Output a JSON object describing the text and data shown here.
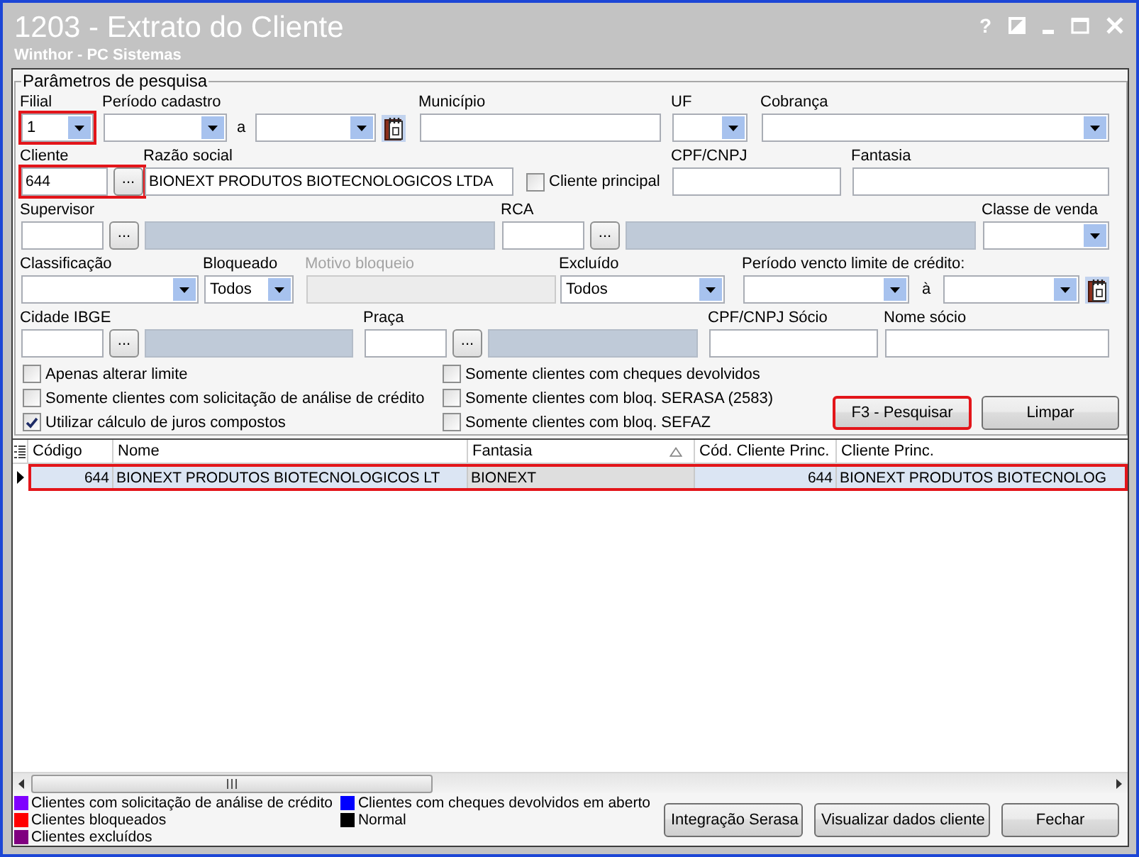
{
  "window": {
    "title": "1203 - Extrato do Cliente",
    "subtitle": "Winthor - PC Sistemas",
    "buttons": [
      {
        "kind": "help",
        "label": "?"
      },
      {
        "kind": "restore"
      },
      {
        "kind": "minimize"
      },
      {
        "kind": "maximize"
      },
      {
        "kind": "close"
      }
    ]
  },
  "search_panel": {
    "legend": "Parâmetros de pesquisa",
    "rows": [
      {
        "fields": [
          {
            "label": "Filial",
            "disabled": false,
            "highlighted": true,
            "controls": [
              {
                "kind": "select",
                "value": "1"
              }
            ]
          },
          {
            "label": "Período cadastro",
            "disabled": false,
            "highlighted": false,
            "controls": [
              {
                "kind": "select"
              },
              {
                "kind": "separator",
                "text": "a"
              },
              {
                "kind": "select"
              },
              {
                "kind": "calendar"
              }
            ]
          },
          {
            "label": "Município",
            "disabled": false,
            "highlighted": false,
            "controls": [
              {
                "kind": "input"
              }
            ]
          },
          {
            "label": "UF",
            "disabled": false,
            "highlighted": false,
            "controls": [
              {
                "kind": "select"
              }
            ]
          },
          {
            "label": "Cobrança",
            "disabled": false,
            "highlighted": false,
            "controls": [
              {
                "kind": "select"
              }
            ]
          }
        ]
      },
      {
        "fields": [
          {
            "label": "Cliente",
            "disabled": false,
            "highlighted": true,
            "controls": [
              {
                "kind": "input",
                "value": "644"
              },
              {
                "kind": "lookup",
                "label": "..."
              }
            ]
          },
          {
            "label": "Razão social",
            "disabled": false,
            "highlighted": false,
            "controls": [
              {
                "kind": "input",
                "value": "BIONEXT PRODUTOS BIOTECNOLOGICOS LTDA"
              }
            ]
          },
          {
            "disabled": false,
            "highlighted": false,
            "controls": [
              {
                "kind": "checkbox",
                "label": "Cliente principal",
                "checked": false
              }
            ]
          },
          {
            "label": "CPF/CNPJ",
            "disabled": false,
            "highlighted": false,
            "controls": [
              {
                "kind": "input"
              }
            ]
          },
          {
            "label": "Fantasia",
            "disabled": false,
            "highlighted": false,
            "controls": [
              {
                "kind": "input"
              }
            ]
          }
        ]
      },
      {
        "fields": [
          {
            "label": "Supervisor",
            "disabled": false,
            "highlighted": false,
            "controls": [
              {
                "kind": "input"
              },
              {
                "kind": "lookup",
                "label": "..."
              },
              {
                "kind": "readonly"
              }
            ]
          },
          {
            "label": "RCA",
            "disabled": false,
            "highlighted": false,
            "controls": [
              {
                "kind": "input"
              },
              {
                "kind": "lookup",
                "label": "..."
              },
              {
                "kind": "readonly"
              }
            ]
          },
          {
            "label": "Classe de venda",
            "disabled": false,
            "highlighted": false,
            "controls": [
              {
                "kind": "select"
              }
            ]
          }
        ]
      },
      {
        "fields": [
          {
            "label": "Classificação",
            "disabled": false,
            "highlighted": false,
            "controls": [
              {
                "kind": "select"
              }
            ]
          },
          {
            "label": "Bloqueado",
            "disabled": false,
            "highlighted": false,
            "controls": [
              {
                "kind": "select",
                "value": "Todos"
              }
            ]
          },
          {
            "label": "Motivo bloqueio",
            "disabled": true,
            "highlighted": false,
            "controls": [
              {
                "kind": "input"
              }
            ]
          },
          {
            "label": "Excluído",
            "disabled": false,
            "highlighted": false,
            "controls": [
              {
                "kind": "select",
                "value": "Todos"
              }
            ]
          },
          {
            "label": "Período vencto limite de crédito:",
            "disabled": false,
            "highlighted": false,
            "controls": [
              {
                "kind": "select"
              },
              {
                "kind": "separator",
                "text": "à"
              },
              {
                "kind": "select"
              },
              {
                "kind": "calendar"
              }
            ]
          }
        ]
      },
      {
        "fields": [
          {
            "label": "Cidade IBGE",
            "disabled": false,
            "highlighted": false,
            "controls": [
              {
                "kind": "input"
              },
              {
                "kind": "lookup",
                "label": "..."
              },
              {
                "kind": "readonly"
              }
            ]
          },
          {
            "label": "Praça",
            "disabled": false,
            "highlighted": false,
            "controls": [
              {
                "kind": "input"
              },
              {
                "kind": "lookup",
                "label": "..."
              },
              {
                "kind": "readonly"
              }
            ]
          },
          {
            "label": "CPF/CNPJ Sócio",
            "disabled": false,
            "highlighted": false,
            "controls": [
              {
                "kind": "input"
              }
            ]
          },
          {
            "label": "Nome sócio",
            "disabled": false,
            "highlighted": false,
            "controls": [
              {
                "kind": "input"
              }
            ]
          }
        ]
      }
    ],
    "option_columns": [
      {
        "options": [
          {
            "label": "Apenas alterar limite",
            "checked": false
          },
          {
            "label": "Somente clientes com solicitação de análise de crédito",
            "checked": false
          },
          {
            "label": "Utilizar cálculo de juros compostos",
            "checked": true
          }
        ]
      },
      {
        "options": [
          {
            "label": "Somente clientes com cheques devolvidos",
            "checked": false
          },
          {
            "label": "Somente clientes com bloq. SERASA (2583)",
            "checked": false
          },
          {
            "label": "Somente clientes com bloq. SEFAZ",
            "checked": false
          }
        ]
      }
    ],
    "buttons": [
      {
        "label": "F3 - Pesquisar",
        "highlighted": true
      },
      {
        "label": "Limpar",
        "highlighted": false
      }
    ]
  },
  "results": {
    "columns": [
      {
        "label": "Código",
        "kind": "number",
        "sorted": false
      },
      {
        "label": "Nome",
        "kind": "text",
        "sorted": false
      },
      {
        "label": "Fantasia",
        "kind": "text",
        "sorted": true
      },
      {
        "label": "Cód. Cliente Princ.",
        "kind": "number",
        "sorted": false
      },
      {
        "label": "Cliente Princ.",
        "kind": "text",
        "sorted": false
      }
    ],
    "rows": [
      {
        "current": true,
        "selected": true,
        "highlighted": true,
        "cells": [
          "644",
          "BIONEXT PRODUTOS BIOTECNOLOGICOS LT",
          "BIONEXT",
          "644",
          "BIONEXT PRODUTOS BIOTECNOLOG"
        ]
      }
    ]
  },
  "legend_columns": [
    {
      "items": [
        {
          "label": "Clientes com solicitação de análise de crédito",
          "color": "#8000ff"
        },
        {
          "label": "Clientes bloqueados",
          "color": "#ff0000"
        },
        {
          "label": "Clientes excluídos",
          "color": "#800080"
        }
      ]
    },
    {
      "items": [
        {
          "label": "Clientes com cheques devolvidos em aberto",
          "color": "#0000ff"
        },
        {
          "label": "Normal",
          "color": "#000000"
        }
      ]
    }
  ],
  "footer_buttons": [
    "Integração Serasa",
    "Visualizar dados cliente",
    "Fechar"
  ]
}
